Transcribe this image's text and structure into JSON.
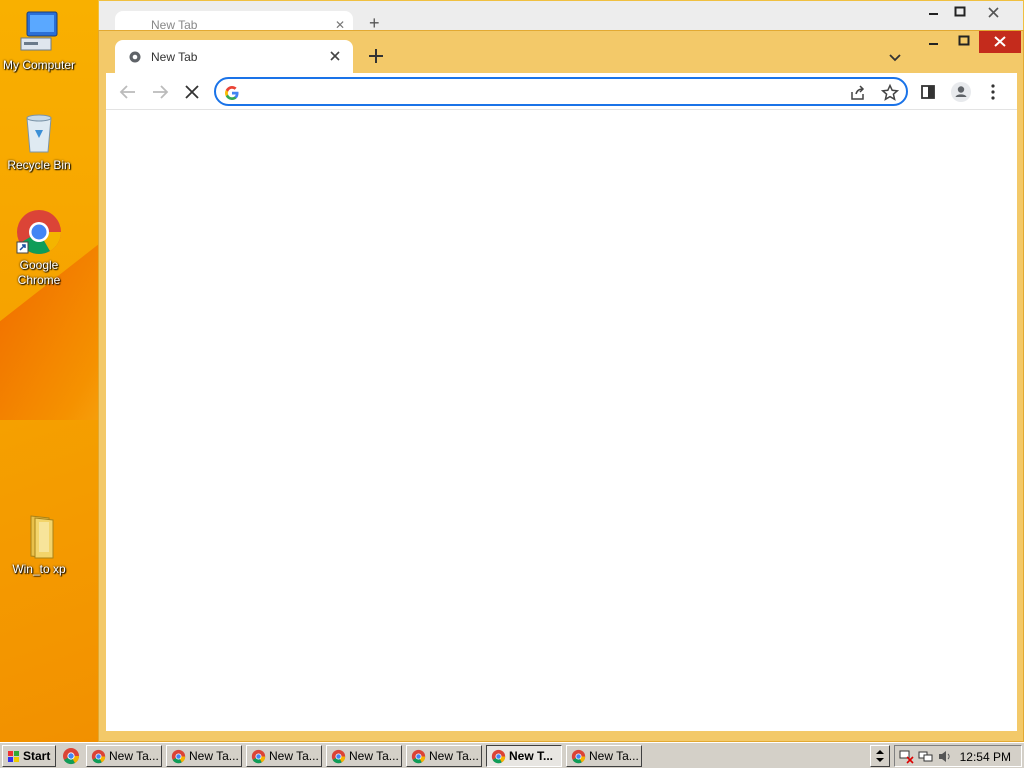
{
  "desktop": {
    "icons": [
      {
        "label": "My Computer"
      },
      {
        "label": "Recycle Bin"
      },
      {
        "label": "Google Chrome"
      },
      {
        "label": "Win_to xp"
      }
    ]
  },
  "background_window": {
    "tab_title": "New Tab"
  },
  "browser": {
    "tab_title": "New Tab",
    "address": {
      "value": "",
      "placeholder": ""
    }
  },
  "taskbar": {
    "start_label": "Start",
    "tasks": [
      {
        "label": "New Ta..."
      },
      {
        "label": "New Ta..."
      },
      {
        "label": "New Ta..."
      },
      {
        "label": "New Ta..."
      },
      {
        "label": "New Ta..."
      },
      {
        "label": "New T..."
      },
      {
        "label": "New Ta..."
      }
    ],
    "active_task_index": 5,
    "clock": "12:54 PM"
  },
  "colors": {
    "accent": "#1a73e8",
    "close_button": "#c42b1c",
    "window_frame": "#f3c969"
  },
  "icons": [
    "computer-icon",
    "recycle-bin-icon",
    "chrome-icon",
    "folder-icon",
    "back-icon",
    "forward-icon",
    "stop-icon",
    "google-icon",
    "share-icon",
    "star-icon",
    "side-panel-icon",
    "profile-icon",
    "menu-icon",
    "windows-flag-icon",
    "network-icon",
    "volume-icon"
  ]
}
